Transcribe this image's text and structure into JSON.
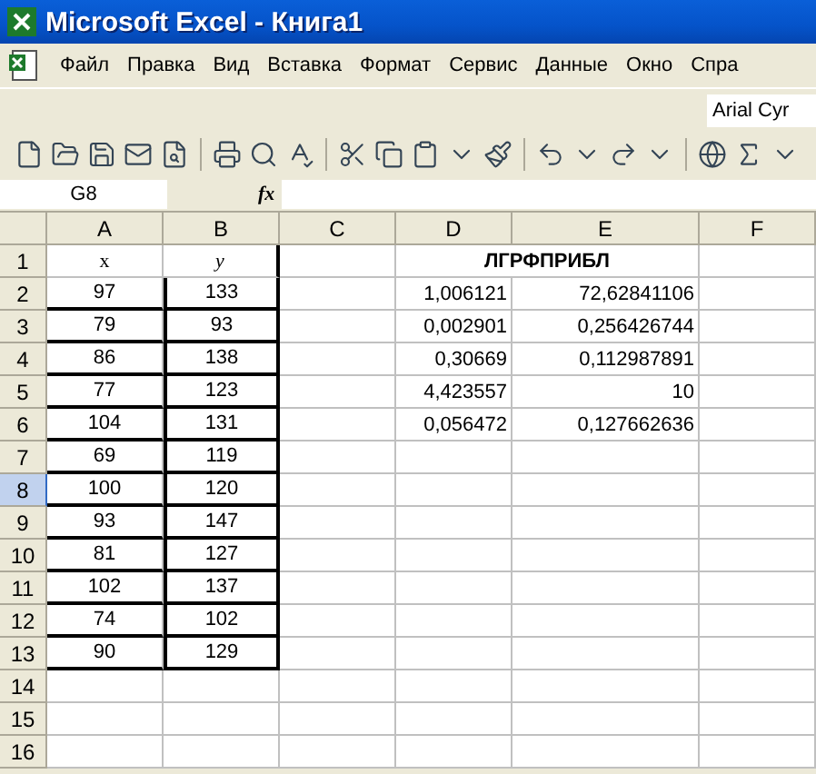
{
  "window": {
    "title": "Microsoft Excel - Книга1"
  },
  "menu": [
    "Файл",
    "Правка",
    "Вид",
    "Вставка",
    "Формат",
    "Сервис",
    "Данные",
    "Окно",
    "Спра"
  ],
  "font_box": {
    "value": "Arial Cyr"
  },
  "name_box": {
    "value": "G8"
  },
  "formula_bar": {
    "fx": "fx"
  },
  "columns": [
    "A",
    "B",
    "C",
    "D",
    "E",
    "F"
  ],
  "rows": [
    {
      "header": "1",
      "kind": "title",
      "selected": false,
      "bordered": false,
      "cells": [
        "x",
        "y",
        "",
        "ЛГРФПРИБЛ",
        ""
      ]
    },
    {
      "header": "2",
      "kind": "data",
      "selected": false,
      "bordered": true,
      "cells": [
        "97",
        "133",
        "",
        "1,006121",
        "72,62841106"
      ]
    },
    {
      "header": "3",
      "kind": "data",
      "selected": false,
      "bordered": true,
      "cells": [
        "79",
        "93",
        "",
        "0,002901",
        "0,256426744"
      ]
    },
    {
      "header": "4",
      "kind": "data",
      "selected": false,
      "bordered": true,
      "cells": [
        "86",
        "138",
        "",
        "0,30669",
        "0,112987891"
      ]
    },
    {
      "header": "5",
      "kind": "data",
      "selected": false,
      "bordered": true,
      "cells": [
        "77",
        "123",
        "",
        "4,423557",
        "10"
      ]
    },
    {
      "header": "6",
      "kind": "data",
      "selected": false,
      "bordered": true,
      "cells": [
        "104",
        "131",
        "",
        "0,056472",
        "0,127662636"
      ]
    },
    {
      "header": "7",
      "kind": "data",
      "selected": false,
      "bordered": true,
      "cells": [
        "69",
        "119",
        "",
        "",
        ""
      ]
    },
    {
      "header": "8",
      "kind": "data",
      "selected": true,
      "bordered": true,
      "cells": [
        "100",
        "120",
        "",
        "",
        ""
      ]
    },
    {
      "header": "9",
      "kind": "data",
      "selected": false,
      "bordered": true,
      "cells": [
        "93",
        "147",
        "",
        "",
        ""
      ]
    },
    {
      "header": "10",
      "kind": "data",
      "selected": false,
      "bordered": true,
      "cells": [
        "81",
        "127",
        "",
        "",
        ""
      ]
    },
    {
      "header": "11",
      "kind": "data",
      "selected": false,
      "bordered": true,
      "cells": [
        "102",
        "137",
        "",
        "",
        ""
      ]
    },
    {
      "header": "12",
      "kind": "data",
      "selected": false,
      "bordered": true,
      "cells": [
        "74",
        "102",
        "",
        "",
        ""
      ]
    },
    {
      "header": "13",
      "kind": "data",
      "selected": false,
      "bordered": true,
      "cells": [
        "90",
        "129",
        "",
        "",
        ""
      ]
    },
    {
      "header": "14",
      "kind": "data",
      "selected": false,
      "bordered": false,
      "cells": [
        "",
        "",
        "",
        "",
        ""
      ]
    },
    {
      "header": "15",
      "kind": "data",
      "selected": false,
      "bordered": false,
      "cells": [
        "",
        "",
        "",
        "",
        ""
      ]
    },
    {
      "header": "16",
      "kind": "data",
      "selected": false,
      "bordered": false,
      "cells": [
        "",
        "",
        "",
        "",
        ""
      ]
    }
  ]
}
